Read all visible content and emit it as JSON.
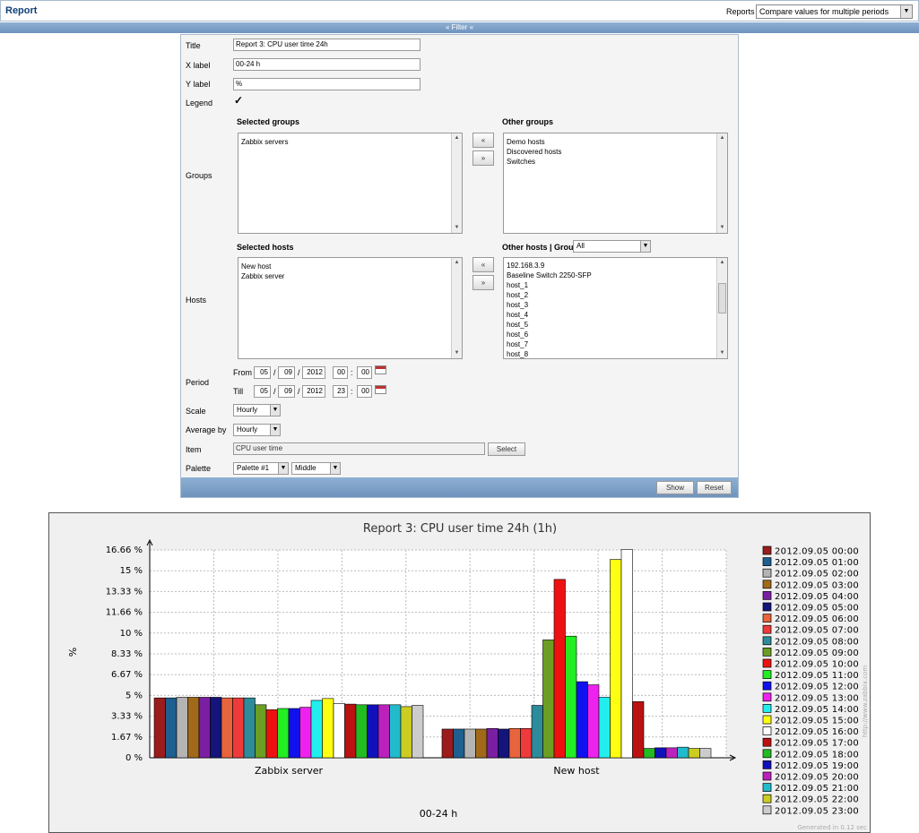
{
  "header": {
    "title": "Report",
    "reports_label": "Reports",
    "reports_value": "Compare values for multiple periods"
  },
  "filter_bar": {
    "label": "« Filter «"
  },
  "form": {
    "title_label": "Title",
    "title_value": "Report 3: CPU user time 24h",
    "xlabel_label": "X label",
    "xlabel_value": "00-24 h",
    "ylabel_label": "Y label",
    "ylabel_value": "%",
    "legend_label": "Legend",
    "legend_checked": "✓",
    "groups_label": "Groups",
    "selected_groups_label": "Selected groups",
    "selected_groups": [
      "Zabbix servers"
    ],
    "other_groups_label": "Other groups",
    "other_groups": [
      "Demo hosts",
      "Discovered hosts",
      "Switches"
    ],
    "hosts_label": "Hosts",
    "selected_hosts_label": "Selected hosts",
    "selected_hosts": [
      "New host",
      "Zabbix server"
    ],
    "other_hosts_label": "Other hosts | Group",
    "other_hosts_group": "All",
    "other_hosts": [
      "192.168.3.9",
      "Baseline Switch 2250-SFP",
      "host_1",
      "host_2",
      "host_3",
      "host_4",
      "host_5",
      "host_6",
      "host_7",
      "host_8"
    ],
    "move_left": "«",
    "move_right": "»",
    "period_label": "Period",
    "from_label": "From",
    "till_label": "Till",
    "from": {
      "day": "05",
      "month": "09",
      "year": "2012",
      "hour": "00",
      "minute": "00"
    },
    "till": {
      "day": "05",
      "month": "09",
      "year": "2012",
      "hour": "23",
      "minute": "00"
    },
    "date_sep": "/",
    "time_sep": ":",
    "scale_label": "Scale",
    "scale_value": "Hourly",
    "average_label": "Average by",
    "average_value": "Hourly",
    "item_label": "Item",
    "item_value": "CPU user time",
    "select_button": "Select",
    "palette_label": "Palette",
    "palette_value": "Palette #1",
    "palette_mode": "Middle",
    "show_button": "Show",
    "reset_button": "Reset"
  },
  "chart_data": {
    "type": "bar",
    "title": "Report 3: CPU user time 24h (1h)",
    "xlabel": "00-24 h",
    "ylabel": "%",
    "ylim": [
      0,
      16.66
    ],
    "yticks": [
      "0 %",
      "1.67 %",
      "3.33 %",
      "5 %",
      "6.67 %",
      "8.33 %",
      "10 %",
      "11.66 %",
      "13.33 %",
      "15 %",
      "16.66 %"
    ],
    "categories": [
      "Zabbix server",
      "New host"
    ],
    "series": [
      {
        "name": "2012.09.05 00:00",
        "color": "#9b1c1c",
        "values": [
          4.8,
          2.3
        ]
      },
      {
        "name": "2012.09.05 01:00",
        "color": "#1d5f8f",
        "values": [
          4.8,
          2.3
        ]
      },
      {
        "name": "2012.09.05 02:00",
        "color": "#b4b4b4",
        "values": [
          4.85,
          2.3
        ]
      },
      {
        "name": "2012.09.05 03:00",
        "color": "#a06a1a",
        "values": [
          4.85,
          2.3
        ]
      },
      {
        "name": "2012.09.05 04:00",
        "color": "#7b1fa2",
        "values": [
          4.85,
          2.35
        ]
      },
      {
        "name": "2012.09.05 05:00",
        "color": "#14147a",
        "values": [
          4.85,
          2.3
        ]
      },
      {
        "name": "2012.09.05 06:00",
        "color": "#e8643c",
        "values": [
          4.8,
          2.35
        ]
      },
      {
        "name": "2012.09.05 07:00",
        "color": "#ee3a3a",
        "values": [
          4.8,
          2.35
        ]
      },
      {
        "name": "2012.09.05 08:00",
        "color": "#2e8b9a",
        "values": [
          4.8,
          4.2
        ]
      },
      {
        "name": "2012.09.05 09:00",
        "color": "#6b9e23",
        "values": [
          4.25,
          9.45
        ]
      },
      {
        "name": "2012.09.05 10:00",
        "color": "#ee1111",
        "values": [
          3.85,
          14.3
        ]
      },
      {
        "name": "2012.09.05 11:00",
        "color": "#22ee22",
        "values": [
          3.95,
          9.75
        ]
      },
      {
        "name": "2012.09.05 12:00",
        "color": "#1111ee",
        "values": [
          3.95,
          6.1
        ]
      },
      {
        "name": "2012.09.05 13:00",
        "color": "#ee22ee",
        "values": [
          4.05,
          5.85
        ]
      },
      {
        "name": "2012.09.05 14:00",
        "color": "#22eeee",
        "values": [
          4.6,
          4.85
        ]
      },
      {
        "name": "2012.09.05 15:00",
        "color": "#ffff11",
        "values": [
          4.75,
          15.9
        ]
      },
      {
        "name": "2012.09.05 16:00",
        "color": "#ffffff",
        "values": [
          4.35,
          16.7
        ]
      },
      {
        "name": "2012.09.05 17:00",
        "color": "#bb1111",
        "values": [
          4.3,
          4.5
        ]
      },
      {
        "name": "2012.09.05 18:00",
        "color": "#22bb22",
        "values": [
          4.25,
          0.75
        ]
      },
      {
        "name": "2012.09.05 19:00",
        "color": "#1111bb",
        "values": [
          4.25,
          0.8
        ]
      },
      {
        "name": "2012.09.05 20:00",
        "color": "#bb22bb",
        "values": [
          4.25,
          0.8
        ]
      },
      {
        "name": "2012.09.05 21:00",
        "color": "#22bbcc",
        "values": [
          4.25,
          0.85
        ]
      },
      {
        "name": "2012.09.05 22:00",
        "color": "#cccc22",
        "values": [
          4.1,
          0.75
        ]
      },
      {
        "name": "2012.09.05 23:00",
        "color": "#cccccc",
        "values": [
          4.2,
          0.75
        ]
      }
    ],
    "watermark": "http://www.zabbix.com",
    "footer": "Generated in 0.12 sec",
    "grid": true,
    "legend": "right"
  }
}
